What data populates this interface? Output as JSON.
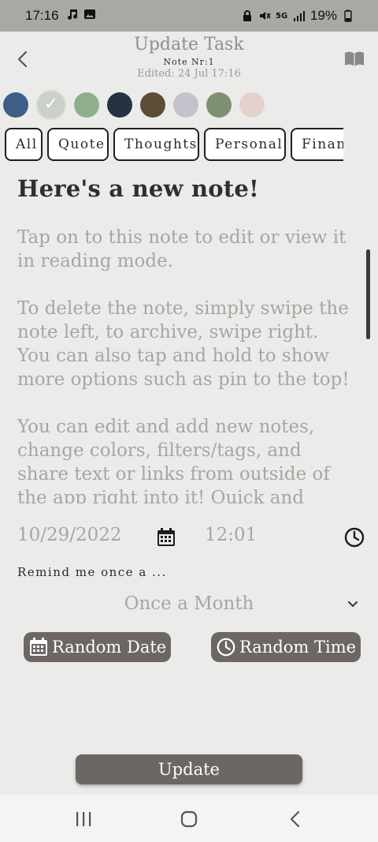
{
  "status_bar": {
    "time": "17:16",
    "battery": "19%",
    "icons_left": [
      "music-note-icon",
      "gallery-icon"
    ],
    "icons_right": [
      "lock-icon",
      "mute-icon",
      "5g-icon",
      "signal-icon",
      "battery-icon"
    ]
  },
  "header": {
    "title": "Update Task",
    "subtitle": "Note Nr:1",
    "edited": "Edited: 24 Jul 17:16"
  },
  "colors": {
    "swatches": [
      "#3e5e88",
      "#c9d1c8",
      "#8eae8e",
      "#243241",
      "#5e4d36",
      "#c3c3cc",
      "#7f9070",
      "#e5d1cc"
    ],
    "selected_index": 1,
    "accent_button": "#6c6764"
  },
  "tags": [
    "All",
    "Quote",
    "Thoughts",
    "Personal",
    "Financ"
  ],
  "note": {
    "title": "Here's a new note!",
    "body": "Tap on to this note to edit or view it in reading mode.\n\nTo delete the note, simply swipe the note left, to archive, swipe right. You can also tap and hold to show more options such as pin to the top!\n\nYou can edit and add new notes, change colors, filters/tags, and share text or links from outside of the app right into it! Quick and simple!"
  },
  "reminder": {
    "date": "10/29/2022",
    "time": "12:01",
    "label": "Remind me once a ...",
    "frequency": "Once a Month"
  },
  "buttons": {
    "random_date": "Random Date",
    "random_time": "Random Time",
    "update": "Update"
  }
}
